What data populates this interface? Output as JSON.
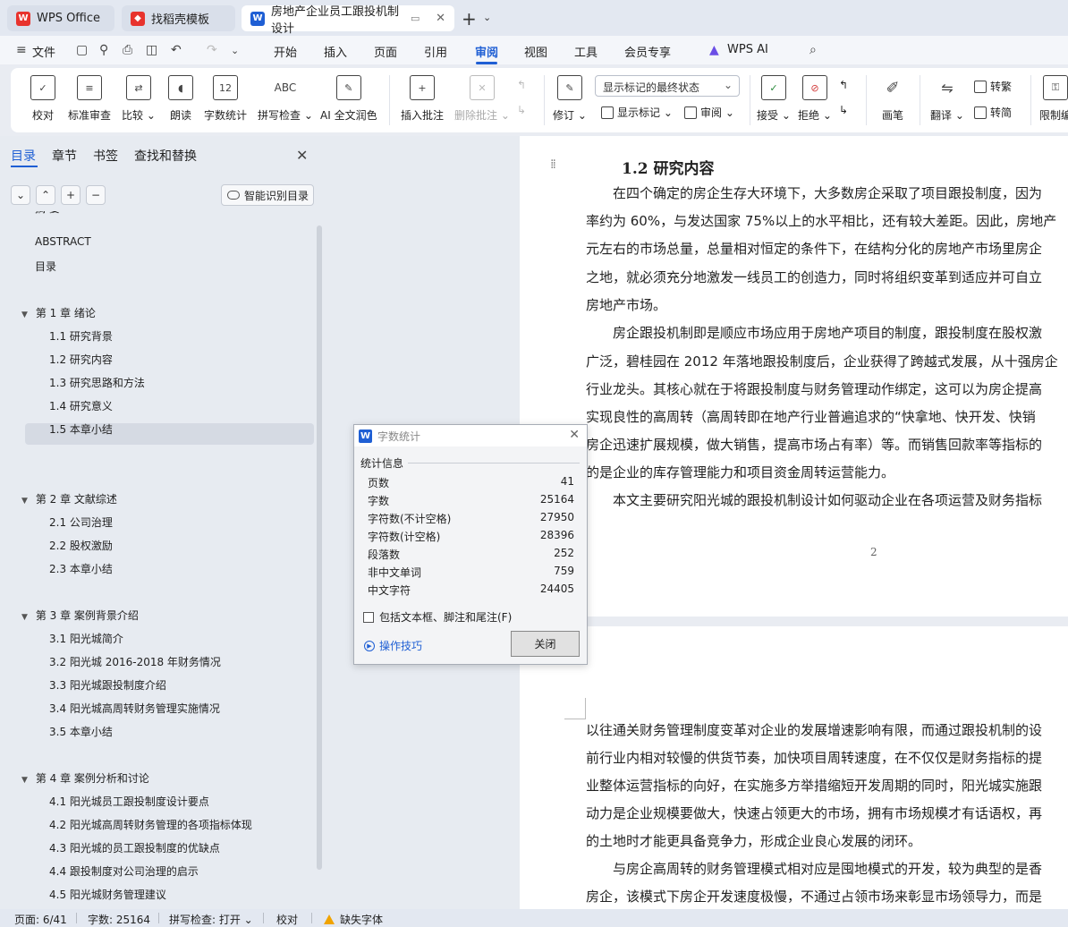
{
  "tabs": [
    {
      "label": "WPS Office",
      "icon": "wps-logo-icon"
    },
    {
      "label": "找稻壳模板",
      "icon": "docer-icon"
    },
    {
      "label": "房地产企业员工跟投机制设计"
    }
  ],
  "menu": {
    "file": "文件",
    "items": [
      "开始",
      "插入",
      "页面",
      "引用",
      "审阅",
      "视图",
      "工具",
      "会员专享"
    ],
    "active": "审阅",
    "ai": "WPS AI"
  },
  "ribbon": {
    "buttons": {
      "proofread": "校对",
      "standard_review": "标准审查",
      "compare": "比较",
      "read_aloud": "朗读",
      "word_count": "字数统计",
      "spell_check": "拼写检查",
      "ai_polish": "AI 全文润色",
      "insert_comment": "插入批注",
      "delete_comment": "删除批注",
      "revise": "修订",
      "show_marks": "显示标记",
      "review": "审阅",
      "accept": "接受",
      "reject": "拒绝",
      "pen": "画笔",
      "translate": "翻译",
      "to_traditional": "转繁",
      "to_simplified": "转简",
      "restrict_edit": "限制编"
    },
    "show_marks_select": "显示标记的最终状态",
    "word_count_glyph": "12",
    "spell_glyph": "ABC"
  },
  "nav_pane": {
    "tabs": [
      "目录",
      "章节",
      "书签",
      "查找和替换"
    ],
    "active_tab": "目录",
    "smart_toc": "智能识别目录",
    "toc": [
      {
        "text": "摘 要",
        "level": 0
      },
      {
        "text": "ABSTRACT",
        "level": 0
      },
      {
        "text": "目录",
        "level": 0
      },
      {
        "text": "第 1 章  绪论",
        "level": 1
      },
      {
        "text": "1.1  研究背景",
        "level": 2
      },
      {
        "text": "1.2  研究内容",
        "level": 2
      },
      {
        "text": "1.3  研究思路和方法",
        "level": 2
      },
      {
        "text": "1.4  研究意义",
        "level": 2
      },
      {
        "text": "1.5  本章小结",
        "level": 2
      },
      {
        "text": "第 2 章  文献综述",
        "level": 1
      },
      {
        "text": "2.1  公司治理",
        "level": 2
      },
      {
        "text": "2.2  股权激励",
        "level": 2
      },
      {
        "text": "2.3  本章小结",
        "level": 2
      },
      {
        "text": "第 3 章  案例背景介绍",
        "level": 1
      },
      {
        "text": "3.1  阳光城简介",
        "level": 2
      },
      {
        "text": "3.2  阳光城 2016-2018 年财务情况",
        "level": 2
      },
      {
        "text": "3.3  阳光城跟投制度介绍",
        "level": 2
      },
      {
        "text": "3.4  阳光城高周转财务管理实施情况",
        "level": 2
      },
      {
        "text": "3.5  本章小结",
        "level": 2
      },
      {
        "text": "第 4 章  案例分析和讨论",
        "level": 1
      },
      {
        "text": "4.1  阳光城员工跟投制度设计要点",
        "level": 2
      },
      {
        "text": "4.2  阳光城高周转财务管理的各项指标体现",
        "level": 2
      },
      {
        "text": "4.3  阳光城的员工跟投制度的优缺点",
        "level": 2
      },
      {
        "text": "4.4  跟投制度对公司治理的启示",
        "level": 2
      },
      {
        "text": "4.5  阳光城财务管理建议",
        "level": 2
      }
    ],
    "selected": "1.2  研究内容"
  },
  "document": {
    "heading": "1.2  研究内容",
    "page1_lines": [
      "　　在四个确定的房企生存大环境下，大多数房企采取了项目跟投制度，因为",
      "率约为 60%，与发达国家 75%以上的水平相比，还有较大差距。因此，房地产",
      "元左右的市场总量，总量相对恒定的条件下，在结构分化的房地产市场里房企",
      "之地，就必须充分地激发一线员工的创造力，同时将组织变革到适应并可自立",
      "房地产市场。",
      "　　房企跟投机制即是顺应市场应用于房地产项目的制度，跟投制度在股权激",
      "广泛，碧桂园在 2012 年落地跟投制度后，企业获得了跨越式发展，从十强房企",
      "行业龙头。其核心就在于将跟投制度与财务管理动作绑定，这可以为房企提高",
      "实现良性的高周转（高周转即在地产行业普遍追求的“快拿地、快开发、快销",
      "房企迅速扩展规模，做大销售，提高市场占有率）等。而销售回款率等指标的",
      "的是企业的库存管理能力和项目资金周转运营能力。",
      "　　本文主要研究阳光城的跟投机制设计如何驱动企业在各项运营及财务指标"
    ],
    "page_number": "2",
    "page2_lines": [
      "以往通关财务管理制度变革对企业的发展增速影响有限，而通过跟投机制的设",
      "前行业内相对较慢的供货节奏，加快项目周转速度，在不仅仅是财务指标的提",
      "业整体运营指标的向好，在实施多方举措缩短开发周期的同时，阳光城实施跟",
      "动力是企业规模要做大，快速占领更大的市场，拥有市场规模才有话语权，再",
      "的土地时才能更具备竞争力，形成企业良心发展的闭环。",
      "　　与房企高周转的财务管理模式相对应是囤地模式的开发，较为典型的是香",
      "房企，该模式下房企开发速度极慢，不通过占领市场来彰显市场领导力，而是"
    ]
  },
  "dialog": {
    "title": "字数统计",
    "group": "统计信息",
    "stats": [
      {
        "label": "页数",
        "value": "41"
      },
      {
        "label": "字数",
        "value": "25164"
      },
      {
        "label": "字符数(不计空格)",
        "value": "27950"
      },
      {
        "label": "字符数(计空格)",
        "value": "28396"
      },
      {
        "label": "段落数",
        "value": "252"
      },
      {
        "label": "非中文单词",
        "value": "759"
      },
      {
        "label": "中文字符",
        "value": "24405"
      }
    ],
    "checkbox": "包括文本框、脚注和尾注(F)",
    "tips": "操作技巧",
    "close": "关闭"
  },
  "status": {
    "page": "页面: 6/41",
    "words": "字数: 25164",
    "spell": "拼写检查: 打开",
    "proof": "校对",
    "missing_font": "缺失字体"
  },
  "colors": {
    "accent": "#1f5fd4",
    "warn": "#f0a300",
    "wps_red": "#e8332d"
  }
}
